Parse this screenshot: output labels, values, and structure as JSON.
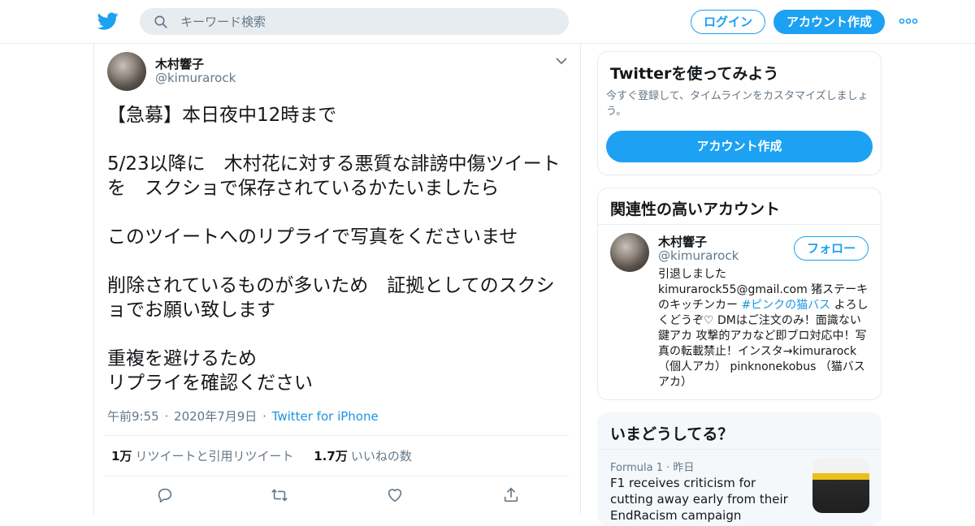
{
  "header": {
    "logo": "twitter-bird-icon",
    "search_placeholder": "キーワード検索",
    "login_label": "ログイン",
    "signup_label": "アカウント作成",
    "more_icon": "more-dots-icon",
    "brand_color": "#1da1f2"
  },
  "tweet": {
    "author_name": "木村響子",
    "author_handle": "@kimurarock",
    "text": "【急募】本日夜中12時まで\n\n5/23以降に　木村花に対する悪質な誹謗中傷ツイートを　スクショで保存されているかたいましたら\n\nこのツイートへのリプライで写真をくださいませ\n\n削除されているものが多いため　証拠としてのスクショでお願い致します\n\n重複を避けるため\nリプライを確認ください",
    "time": "午前9:55",
    "date": "2020年7月9日",
    "source": "Twitter for iPhone",
    "retweets_count": "1万",
    "retweets_label": "リツイートと引用リツイート",
    "likes_count": "1.7万",
    "likes_label": "いいねの数",
    "actions": [
      "reply-icon",
      "retweet-icon",
      "like-icon",
      "share-icon"
    ]
  },
  "signup_card": {
    "title": "Twitterを使ってみよう",
    "description": "今すぐ登録して、タイムラインをカスタマイズしましょう。",
    "button_label": "アカウント作成"
  },
  "related_card": {
    "title": "関連性の高いアカウント",
    "account_name": "木村響子",
    "account_handle": "@kimurarock",
    "follow_label": "フォロー",
    "bio_before": "引退しました kimurarock55@gmail.com 猪ステーキのキッチンカー ",
    "bio_hashtag": "#ピンクの猫バス",
    "bio_after": " よろしくどうぞ♡ DMはご注文のみ！面識ない鍵アカ 攻撃的アカなど即ブロ対応中！写真の転載禁止！インスタ→kimurarock （個人アカ） pinknonekobus （猫バスアカ）"
  },
  "trends_card": {
    "title": "いまどうしてる？",
    "kicker_source": "Formula 1",
    "kicker_time": "昨日",
    "headline": "F1 receives criticism for cutting away early from their EndRacism campaign"
  }
}
